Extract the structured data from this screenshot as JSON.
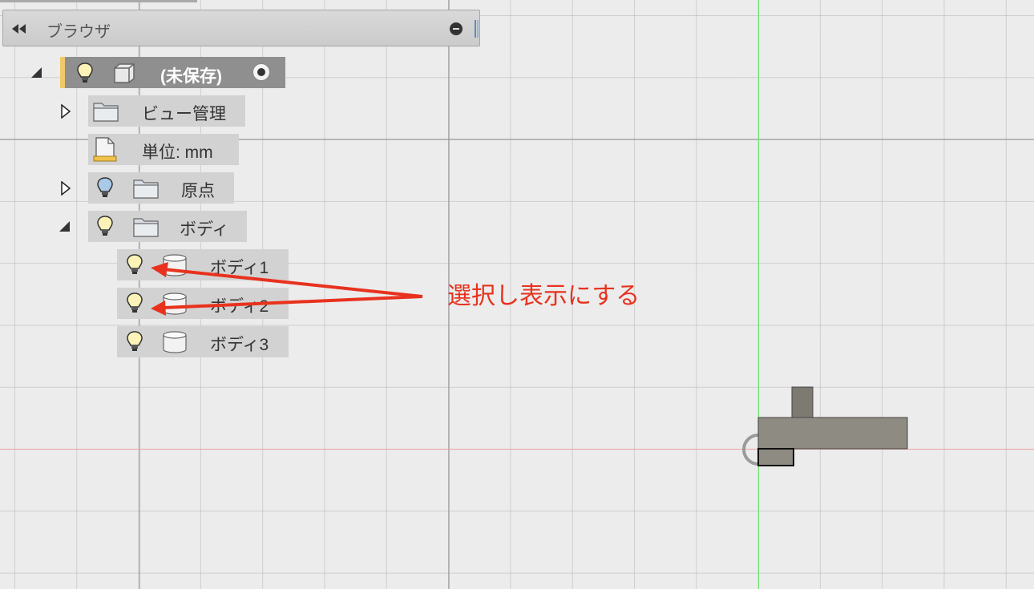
{
  "browser": {
    "title": "ブラウザ",
    "icons": {
      "collapse": "double-left-arrow-icon",
      "minimize": "minus-circle-icon",
      "grip": "resize-grip-icon"
    }
  },
  "tree": {
    "root": {
      "label": "(未保存)",
      "icons": [
        "lightbulb-icon",
        "component-box-icon",
        "radio-active-icon"
      ],
      "expanded": true
    },
    "items": [
      {
        "label": "ビュー管理",
        "icon": "folder-icon",
        "expander": "collapsed"
      },
      {
        "label": "単位: mm",
        "icon": "units-document-icon",
        "expander": "none"
      },
      {
        "label": "原点",
        "icons": [
          "lightbulb-off-icon",
          "folder-icon"
        ],
        "expander": "collapsed"
      },
      {
        "label": "ボディ",
        "icons": [
          "lightbulb-icon",
          "folder-icon"
        ],
        "expander": "expanded"
      }
    ],
    "bodies": [
      {
        "label": "ボディ1",
        "icons": [
          "lightbulb-icon",
          "body-cylinder-icon"
        ]
      },
      {
        "label": "ボディ2",
        "icons": [
          "lightbulb-icon",
          "body-cylinder-icon"
        ]
      },
      {
        "label": "ボディ3",
        "icons": [
          "lightbulb-icon",
          "body-cylinder-icon"
        ]
      }
    ]
  },
  "annotation": {
    "text": "選択し表示にする",
    "color": "#e8321e"
  },
  "colors": {
    "accent_selection": "#f2c96a",
    "axis_green": "#6ee36e",
    "axis_red": "#f0a0a0"
  }
}
